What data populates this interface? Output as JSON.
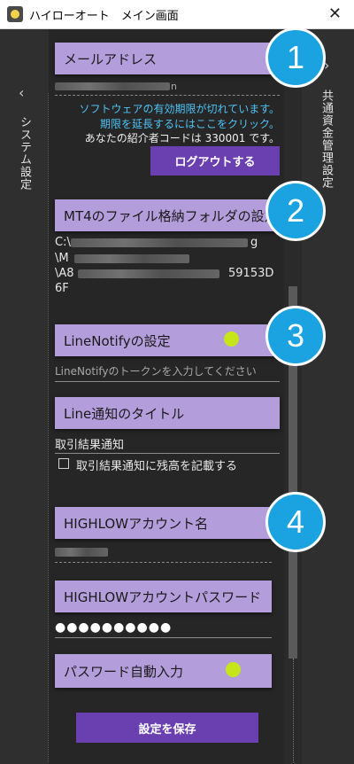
{
  "window": {
    "title": "ハイローオート　メイン画面",
    "close_glyph": "✕"
  },
  "nav": {
    "left_label": "システム設定",
    "right_label": "共通資金管理設定",
    "left_chevron": "‹",
    "right_chevron": "›"
  },
  "email": {
    "header": "メールアドレス",
    "expiry_message": "ソフトウェアの有効期限が切れています。",
    "extend_link": "期限を延長するにはここをクリック。",
    "referral": "あなたの紹介者コードは 330001 です。",
    "logout_button": "ログアウトする"
  },
  "mt4": {
    "header": "MT4のファイル格納フォルダの設定",
    "path_line1": "C:\\",
    "path_line1_end": "g",
    "path_line2": "\\M",
    "path_line3": "\\A8",
    "path_line3_end": "59153D",
    "path_line4": "6F"
  },
  "line_notify": {
    "header": "LineNotifyの設定",
    "placeholder": "LineNotifyのトークンを入力してください"
  },
  "line_title": {
    "header": "Line通知のタイトル",
    "value": "取引結果通知",
    "checkbox_label": "取引結果通知に残高を記載する"
  },
  "highlow": {
    "account_header": "HIGHLOWアカウント名",
    "password_header": "HIGHLOWアカウントパスワード",
    "password_value": "●●●●●●●●●●",
    "autofill_label": "パスワード自動入力"
  },
  "save_button": "設定を保存",
  "callouts": [
    "1",
    "2",
    "3",
    "4"
  ],
  "colors": {
    "accent": "#b39ddb",
    "button": "#6a3fb0",
    "callout": "#1aa3e0",
    "toggle": "#c6e51b",
    "link": "#4fc3f7"
  }
}
